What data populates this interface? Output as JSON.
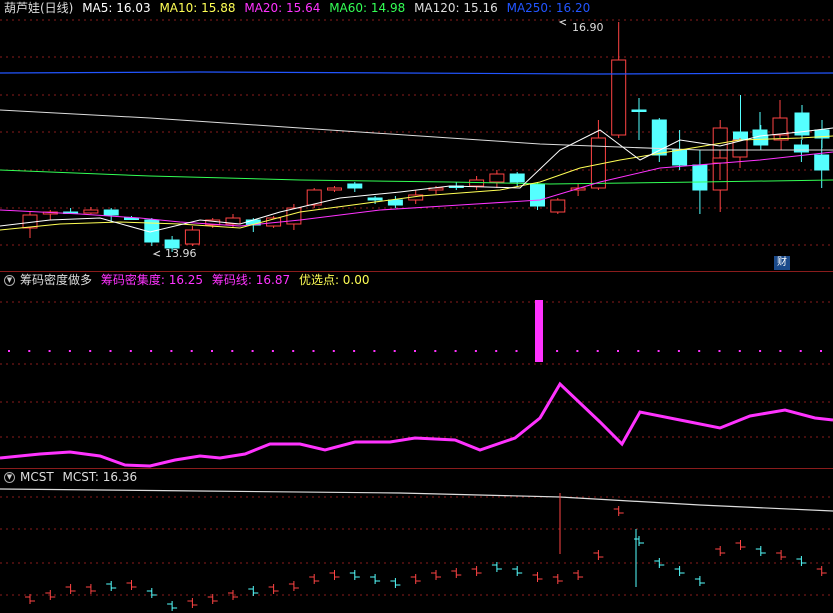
{
  "main": {
    "title": "葫芦娃(日线)",
    "indicators": [
      {
        "label": "MA5: 16.03",
        "color": "#ffffff"
      },
      {
        "label": "MA10: 15.88",
        "color": "#ffff55"
      },
      {
        "label": "MA20: 15.64",
        "color": "#ff33ff"
      },
      {
        "label": "MA60: 14.98",
        "color": "#33ff55"
      },
      {
        "label": "MA120: 15.16",
        "color": "#dddddd"
      },
      {
        "label": "MA250: 16.20",
        "color": "#2255ff"
      }
    ],
    "high_label": "16.90",
    "low_label": "13.96",
    "badge": "财"
  },
  "panel2": {
    "icon": "chip-icon",
    "title": "筹码密度做多",
    "chip_concentration": "筹码密集度: 16.25",
    "chip_line": "筹码线: 16.87",
    "optimal_point": "优选点: 0.00",
    "colors": {
      "title": "#dddddd",
      "magenta": "#ff33ff",
      "yellow": "#ffff55"
    }
  },
  "panel3": {
    "title": "MCST",
    "value": "MCST: 16.36"
  },
  "colors": {
    "up": "#ff4444",
    "down": "#55ffff",
    "grid": "#8a1c1c",
    "ma250": "#2255ff",
    "ma120": "#dddddd",
    "ma60": "#33ff55",
    "ma20": "#ff33ff",
    "ma10": "#ffff55",
    "ma5": "#ffffff",
    "line2": "#ff33ff"
  }
}
